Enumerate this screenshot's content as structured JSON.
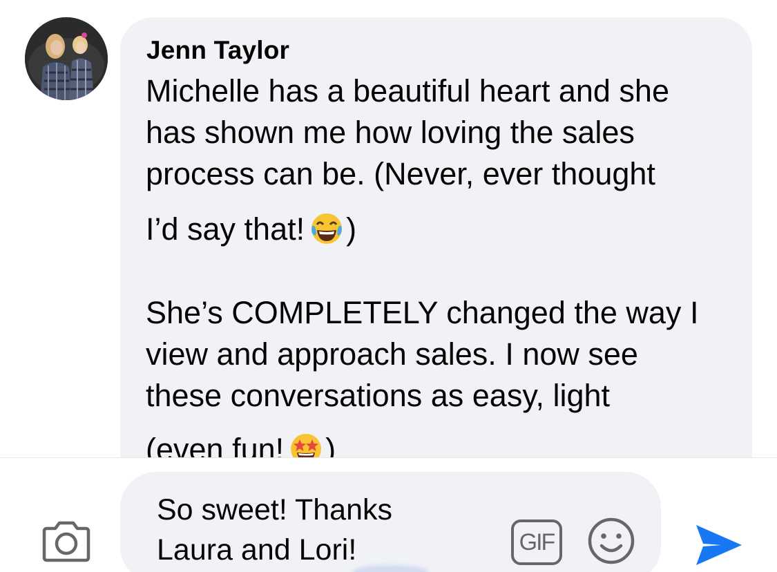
{
  "comment": {
    "author": "Jenn Taylor",
    "lines": [
      "Michelle has a beautiful heart and she",
      "has shown me how loving the sales",
      "process can be. (Never, ever thought",
      "I’d say that!",
      ")",
      "She’s COMPLETELY changed the way I",
      "view and approach sales. I now see",
      "these conversations as easy, light",
      "(even fun!",
      ")"
    ],
    "emojis": [
      "tears-of-joy-emoji",
      "star-struck-emoji"
    ]
  },
  "composer": {
    "input_lines": [
      "So sweet! Thanks",
      "Laura and Lori!"
    ],
    "gif_label": "GIF",
    "icons": [
      "camera-icon",
      "gif-icon",
      "emoji-smile-icon",
      "send-icon"
    ]
  },
  "colors": {
    "bubble": "#f0f2f5",
    "text": "#050505",
    "icon_gray": "#65676b",
    "send_blue": "#1877f2"
  }
}
